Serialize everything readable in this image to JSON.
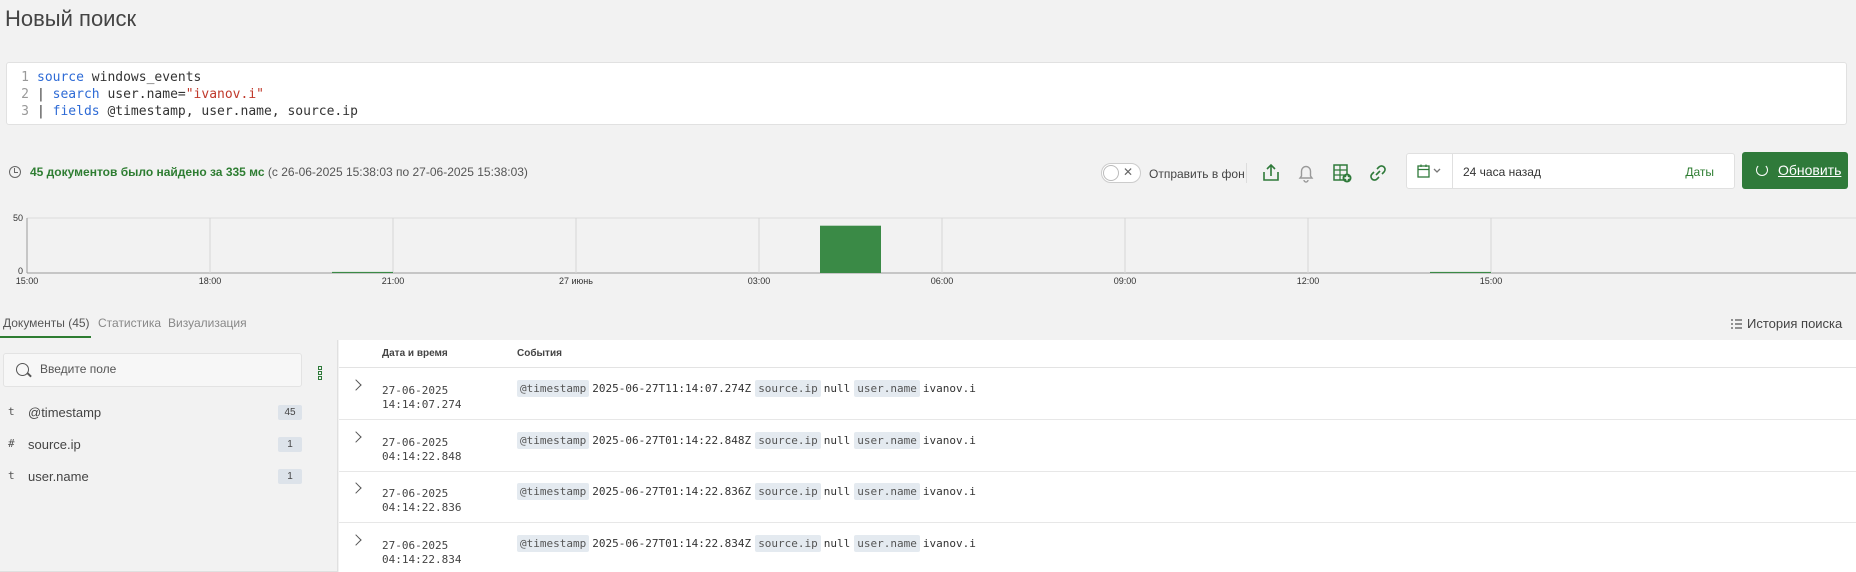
{
  "page": {
    "title": "Новый поиск"
  },
  "query": {
    "lines": [
      {
        "num": "1",
        "parts": [
          {
            "t": "source",
            "c": "kw"
          },
          {
            "t": " windows_events",
            "c": ""
          }
        ]
      },
      {
        "num": "2",
        "parts": [
          {
            "t": "| ",
            "c": "pipe"
          },
          {
            "t": "search",
            "c": "kw"
          },
          {
            "t": " user.name=",
            "c": ""
          },
          {
            "t": "\"ivanov.i\"",
            "c": "str"
          }
        ]
      },
      {
        "num": "3",
        "parts": [
          {
            "t": "| ",
            "c": "pipe"
          },
          {
            "t": "fields",
            "c": "kw"
          },
          {
            "t": " @timestamp, user.name, source.ip",
            "c": ""
          }
        ]
      }
    ]
  },
  "status": {
    "found_text": "45 документов было найдено за 335 мс",
    "range_text": "(с 26-06-2025 15:38:03 по 27-06-2025 15:38:03)"
  },
  "toolbar": {
    "background_label": "Отправить в фон",
    "icons": [
      "export-icon",
      "bell-icon",
      "add-report-icon",
      "link-icon"
    ],
    "accent": "#2f7a3a"
  },
  "date_picker": {
    "value": "24 часа назад",
    "dates_label": "Даты"
  },
  "refresh": {
    "label": "Обновить"
  },
  "chart_data": {
    "type": "bar",
    "x_ticks": [
      "15:00",
      "18:00",
      "21:00",
      "27 июнь",
      "03:00",
      "06:00",
      "09:00",
      "12:00",
      "15:00"
    ],
    "y_ticks": [
      "50",
      "0"
    ],
    "ylim": [
      0,
      50
    ],
    "bar_color": "#3a8a46",
    "bins": [
      {
        "start_hour": 20,
        "end_hour": 21,
        "value": 1
      },
      {
        "start_hour": 28,
        "end_hour": 29,
        "value": 43
      },
      {
        "start_hour": 38,
        "end_hour": 39,
        "value": 1
      }
    ]
  },
  "tabs": [
    {
      "label": "Документы (45)",
      "active": true
    },
    {
      "label": "Статистика",
      "active": false
    },
    {
      "label": "Визуализация",
      "active": false
    }
  ],
  "history": {
    "label": "История поиска"
  },
  "fields_panel": {
    "search_placeholder": "Введите поле",
    "fields": [
      {
        "type": "t",
        "name": "@timestamp",
        "count": "45"
      },
      {
        "type": "#",
        "name": "source.ip",
        "count": "1"
      },
      {
        "type": "t",
        "name": "user.name",
        "count": "1"
      }
    ]
  },
  "results": {
    "columns": {
      "date": "Дата и время",
      "events": "События"
    },
    "rows": [
      {
        "date": "27-06-2025",
        "time": "14:14:07.274",
        "timestamp": "2025-06-27T11:14:07.274Z",
        "source_ip": "null",
        "user_name": "ivanov.i"
      },
      {
        "date": "27-06-2025",
        "time": "04:14:22.848",
        "timestamp": "2025-06-27T01:14:22.848Z",
        "source_ip": "null",
        "user_name": "ivanov.i"
      },
      {
        "date": "27-06-2025",
        "time": "04:14:22.836",
        "timestamp": "2025-06-27T01:14:22.836Z",
        "source_ip": "null",
        "user_name": "ivanov.i"
      },
      {
        "date": "27-06-2025",
        "time": "04:14:22.834",
        "timestamp": "2025-06-27T01:14:22.834Z",
        "source_ip": "null",
        "user_name": "ivanov.i"
      }
    ],
    "tag_labels": {
      "timestamp": "@timestamp",
      "source_ip": "source.ip",
      "user_name": "user.name"
    }
  }
}
